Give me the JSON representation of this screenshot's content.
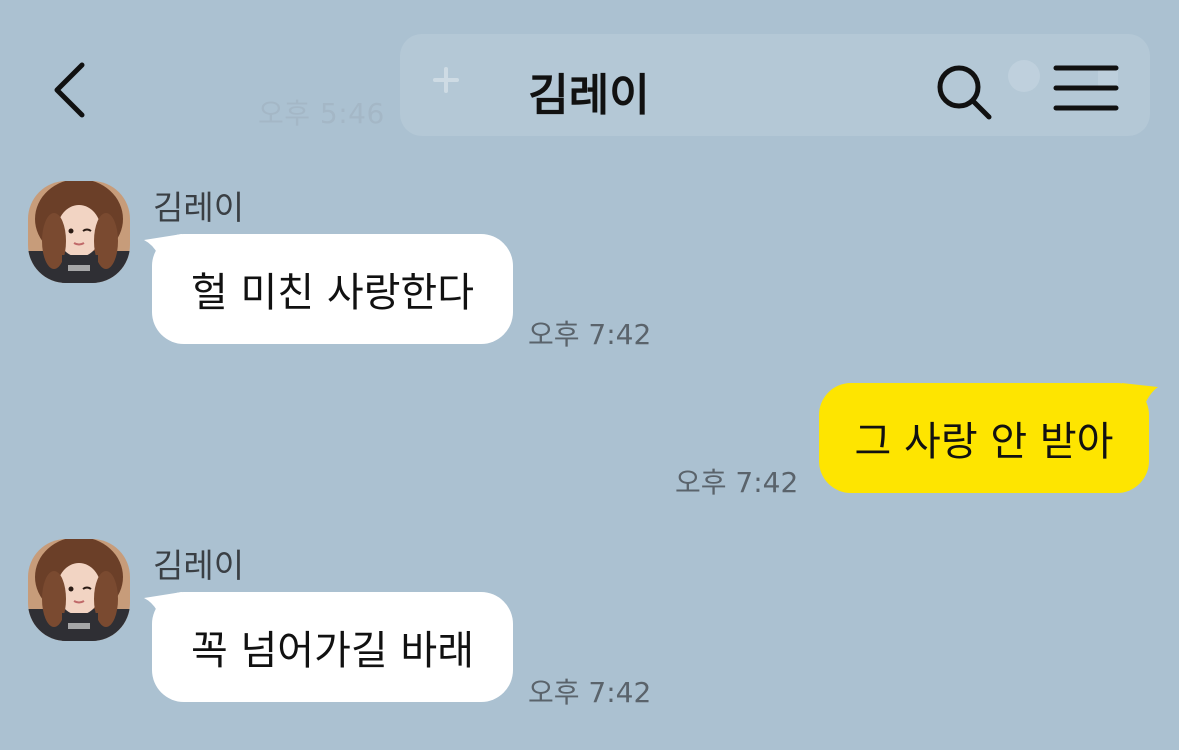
{
  "header": {
    "title": "김레이",
    "back_icon": "chevron-left-icon",
    "search_icon": "search-icon",
    "menu_icon": "hamburger-menu-icon"
  },
  "background_artifacts": {
    "time": "오후 5:46"
  },
  "messages": [
    {
      "direction": "incoming",
      "sender": "김레이",
      "text": "헐 미친 사랑한다",
      "time": "오후 7:42"
    },
    {
      "direction": "outgoing",
      "text": "그 사랑 안 받아",
      "time": "오후 7:42"
    },
    {
      "direction": "incoming",
      "sender": "김레이",
      "text": "꼭 넘어가길 바래",
      "time": "오후 7:42"
    }
  ],
  "colors": {
    "background": "#abc1d1",
    "incoming_bubble": "#ffffff",
    "outgoing_bubble": "#fee500",
    "text": "#111111",
    "timestamp": "#5a636b"
  }
}
